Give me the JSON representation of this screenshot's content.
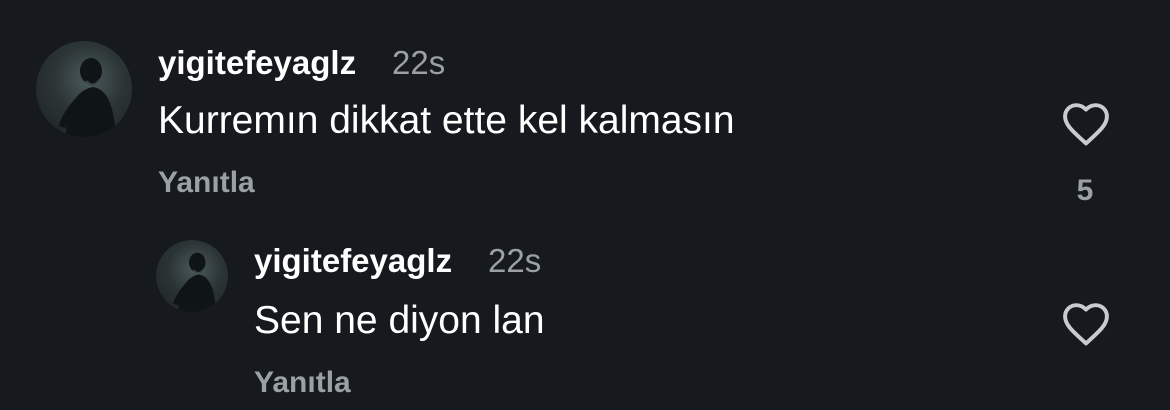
{
  "comments": [
    {
      "username": "yigitefeyaglz",
      "time": "22s",
      "text": "Kurremın dikkat ette kel kalmasın",
      "reply_label": "Yanıtla",
      "like_icon": "heart-outline-icon",
      "like_count": "5"
    },
    {
      "username": "yigitefeyaglz",
      "time": "22s",
      "text": "Sen ne diyon lan",
      "reply_label": "Yanıtla",
      "like_icon": "heart-outline-icon"
    }
  ],
  "colors": {
    "background": "#16191d",
    "primary_text": "#ffffff",
    "secondary_text": "#9aa0a6",
    "icon": "#c8ccd0"
  }
}
